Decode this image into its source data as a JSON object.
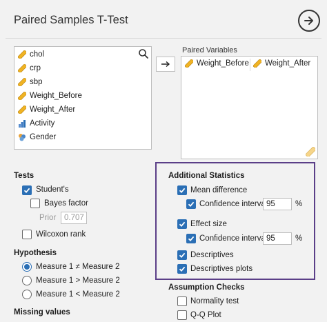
{
  "title": "Paired Samples T-Test",
  "source_variables": [
    {
      "name": "chol",
      "icon": "continuous-ruler-icon"
    },
    {
      "name": "crp",
      "icon": "continuous-ruler-icon"
    },
    {
      "name": "sbp",
      "icon": "continuous-ruler-icon"
    },
    {
      "name": "Weight_Before",
      "icon": "continuous-ruler-icon"
    },
    {
      "name": "Weight_After",
      "icon": "continuous-ruler-icon"
    },
    {
      "name": "Activity",
      "icon": "ordinal-bars-icon"
    },
    {
      "name": "Gender",
      "icon": "nominal-circles-icon"
    }
  ],
  "paired_variables": {
    "label": "Paired Variables",
    "pair": [
      "Weight_Before",
      "Weight_After"
    ]
  },
  "tests": {
    "heading": "Tests",
    "students": "Student's",
    "bayes": "Bayes factor",
    "prior_label": "Prior",
    "prior_value": "0.707",
    "wilcoxon": "Wilcoxon rank"
  },
  "hypothesis": {
    "heading": "Hypothesis",
    "options": [
      "Measure 1 ≠ Measure 2",
      "Measure 1 > Measure 2",
      "Measure 1 < Measure 2"
    ]
  },
  "missing": {
    "heading": "Missing values"
  },
  "additional": {
    "heading": "Additional Statistics",
    "mean_difference": "Mean difference",
    "ci_label": "Confidence interval",
    "ci_value_1": "95",
    "ci_unit": "%",
    "effect_size": "Effect size",
    "ci_value_2": "95",
    "descriptives": "Descriptives",
    "descriptives_plots": "Descriptives plots"
  },
  "assumptions": {
    "heading": "Assumption Checks",
    "normality": "Normality test",
    "qq": "Q-Q Plot"
  },
  "colors": {
    "accent": "#2b6fb5",
    "highlight": "#5b3f88",
    "ruler": "#f0b323"
  }
}
